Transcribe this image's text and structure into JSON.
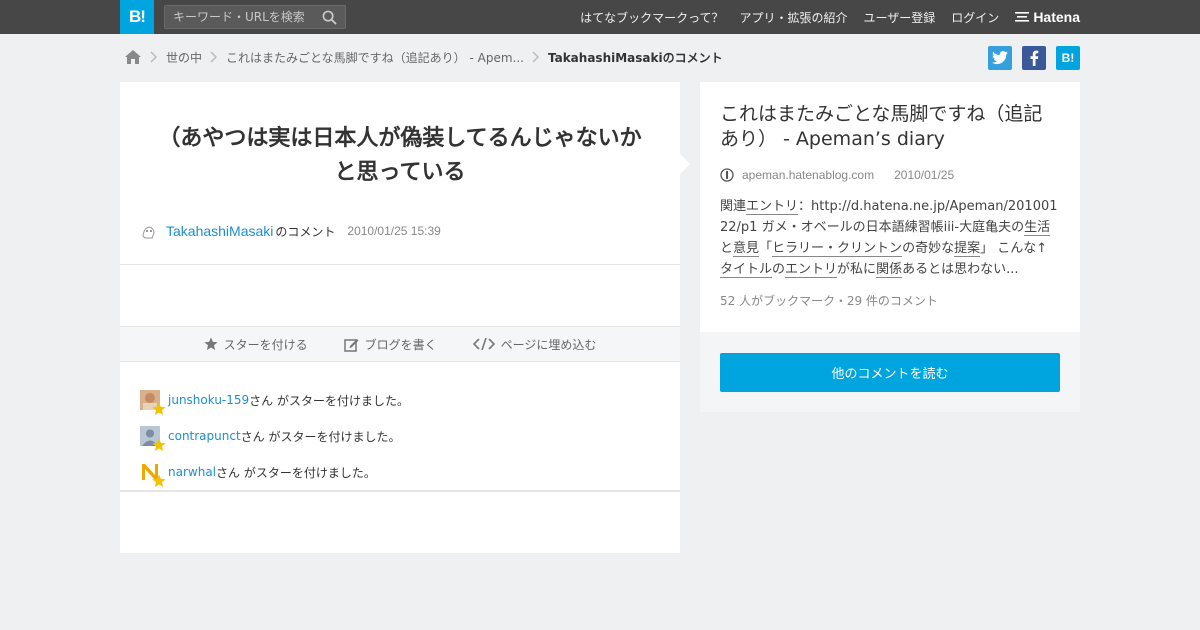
{
  "header": {
    "logo": "B!",
    "search_placeholder": "キーワード・URLを検索",
    "nav": [
      "はてなブックマークって？",
      "アプリ・拡張の紹介",
      "ユーザー登録",
      "ログイン"
    ],
    "brand": "Hatena"
  },
  "breadcrumb": {
    "items": [
      "世の中",
      "これはまたみごとな馬脚ですね（追記あり） - Apem..."
    ],
    "current": "TakahashiMasakiのコメント"
  },
  "share": {
    "twitter": "t",
    "facebook": "f",
    "hatena": "B!"
  },
  "comment": {
    "text": "（あやつは実は日本人が偽装してるんじゃないかと思っている",
    "user": "TakahashiMasaki",
    "suffix": "のコメント",
    "date": "2010/01/25 15:39"
  },
  "actions": {
    "star": "スターを付ける",
    "blog": "ブログを書く",
    "embed": "ページに埋め込む"
  },
  "stars": [
    {
      "user": "junshoku-159",
      "text": "さん がスターを付けました。"
    },
    {
      "user": "contrapunct",
      "text": "さん がスターを付けました。"
    },
    {
      "user": "narwhal",
      "text": "さん がスターを付けました。"
    }
  ],
  "entry": {
    "title": "これはまたみごとな馬脚ですね（追記あり） - Apeman’s diary",
    "domain": "apeman.hatenablog.com",
    "date": "2010/01/25",
    "desc_parts": [
      "関連",
      "エントリ",
      "：http://d.hatena.ne.jp/Apeman/20100122/p1 ",
      "ガメ・オベールの日本語練習帳iii-大庭亀夫の",
      "生活",
      "と",
      "意見",
      "「",
      "ヒラリー・クリントン",
      "の奇妙な",
      "提案",
      "」 こんな↑",
      "タイトル",
      "の",
      "エントリ",
      "が私に",
      "関係",
      "あるとは思わない..."
    ],
    "count": "52 人がブックマーク・29 件のコメント",
    "more_button": "他のコメントを読む"
  },
  "colors": {
    "accent": "#00a4de",
    "link": "#1d8fd0",
    "topbar": "#474747",
    "star": "#f2c400"
  }
}
